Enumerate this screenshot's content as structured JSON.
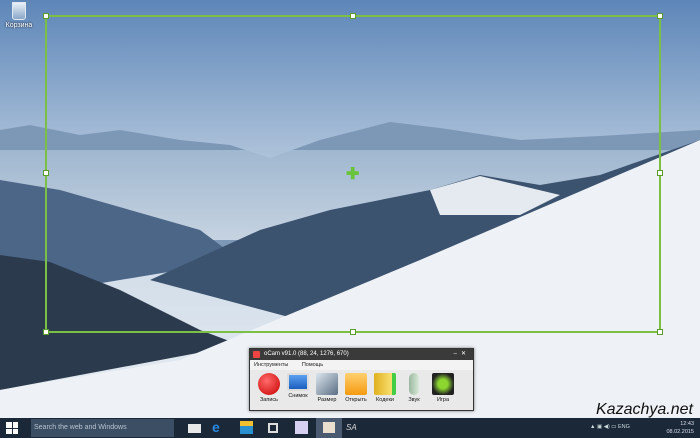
{
  "desktop": {
    "icons": [
      {
        "label": "Корзина",
        "icon": "recycle-bin-icon"
      }
    ]
  },
  "capture_area": {
    "border_color": "#7bc044"
  },
  "ocam": {
    "title": "oCam v91.0 (88, 24, 1276, 670)",
    "menu": [
      "Инструменты",
      "Помощь"
    ],
    "tools": [
      {
        "label": "Запись",
        "icon": "record-icon"
      },
      {
        "label": "Снимок",
        "icon": "screenshot-monitor-icon"
      },
      {
        "label": "Размер",
        "icon": "resize-icon"
      },
      {
        "label": "Открыть",
        "icon": "folder-icon"
      },
      {
        "label": "Кодеки",
        "icon": "codec-icon"
      },
      {
        "label": "Звук",
        "icon": "microphone-icon"
      },
      {
        "label": "Игра",
        "icon": "nvidia-game-icon"
      }
    ]
  },
  "taskbar": {
    "search_placeholder": "Search the web and Windows",
    "lang": "ENG",
    "time": "12:43",
    "date": "08.02.2015",
    "sa": "SA"
  },
  "watermark": "Kazachya.net"
}
